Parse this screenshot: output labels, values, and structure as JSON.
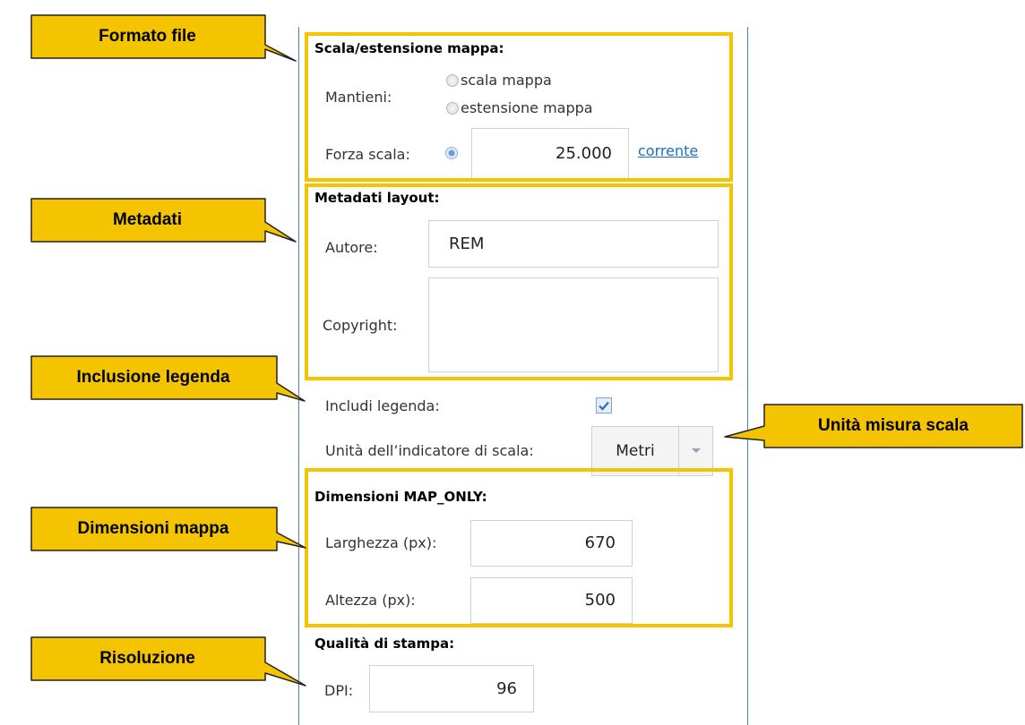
{
  "callouts": {
    "formato_file": "Formato file",
    "metadati": "Metadati",
    "inclusione_legenda": "Inclusione legenda",
    "unita_misura_scala": "Unità misura scala",
    "dimensioni_mappa": "Dimensioni mappa",
    "risoluzione": "Risoluzione"
  },
  "scale_section": {
    "title": "Scala/estensione mappa:",
    "mantieni_label": "Mantieni:",
    "option_scale": "scala mappa",
    "option_extent": "estensione mappa",
    "force_scale_label": "Forza scala:",
    "force_scale_value": "25.000",
    "current_link": "corrente"
  },
  "metadata_section": {
    "title": "Metadati layout:",
    "author_label": "Autore:",
    "author_value": "REM",
    "copyright_label": "Copyright:",
    "copyright_value": ""
  },
  "legend": {
    "include_label": "Includi legenda:",
    "include_checked": true,
    "scalebar_unit_label": "Unità dell’indicatore di scala:",
    "scalebar_unit_value": "Metri"
  },
  "map_only_section": {
    "title": "Dimensioni MAP_ONLY:",
    "width_label": "Larghezza (px):",
    "width_value": "670",
    "height_label": "Altezza (px):",
    "height_value": "500"
  },
  "quality_section": {
    "title": "Qualità di stampa:",
    "dpi_label": "DPI:",
    "dpi_value": "96"
  },
  "colors": {
    "callout_fill": "#f5c400",
    "highlight_border": "#f5c400",
    "panel_border": "#4f81bd",
    "link": "#1b6ec2"
  }
}
